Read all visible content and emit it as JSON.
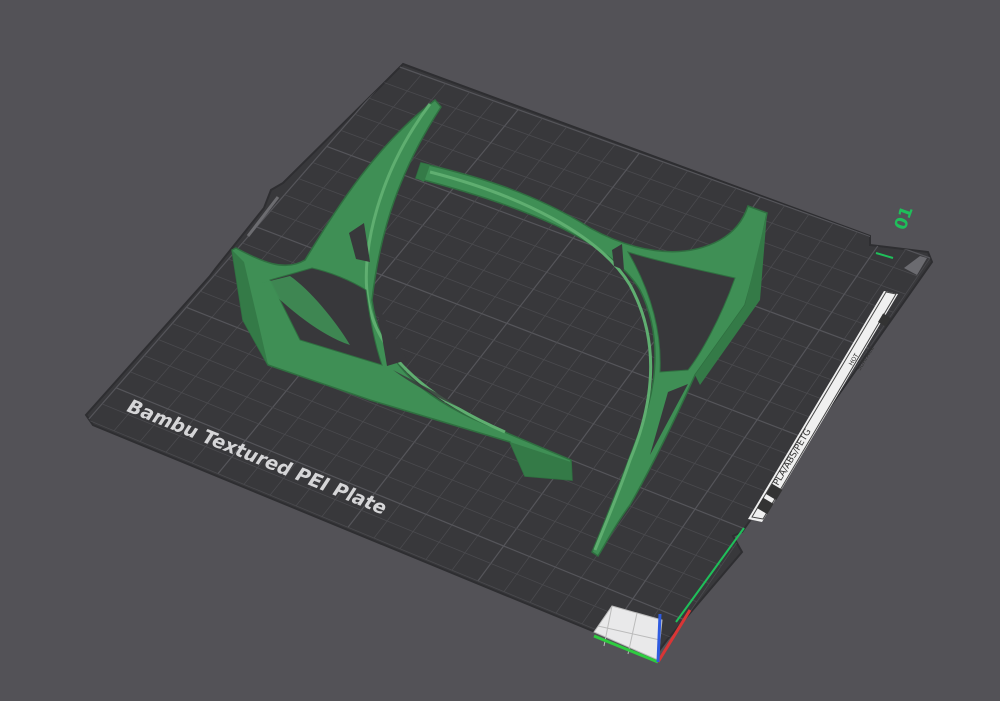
{
  "viewport": {
    "background": "#535257",
    "plate": {
      "label": "Bambu Textured PEI Plate",
      "number": "01",
      "color": "#38383b",
      "grid_color": "#4a4a4e",
      "border_accent": "#1fbf5a"
    },
    "plate_strip": {
      "material_text": "PLA/ABS/PETG",
      "surface_text_line1": "HOT",
      "surface_text_line2": "SURFACE"
    },
    "model": {
      "color": "#3f8f55",
      "edge_color": "#2f6f40",
      "parts": [
        "stand-left",
        "stand-right"
      ]
    },
    "axes": {
      "x_color": "#d93535",
      "y_color": "#2ecc40",
      "z_color": "#2f5be0"
    }
  }
}
